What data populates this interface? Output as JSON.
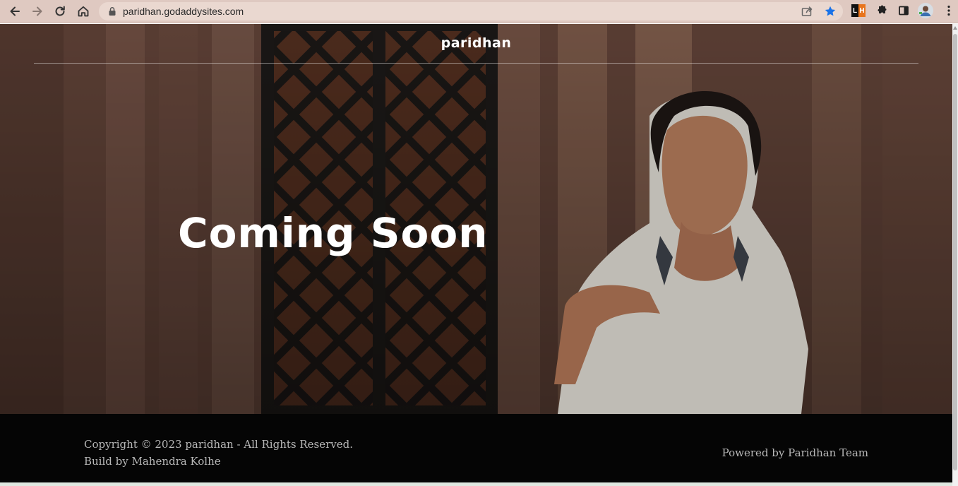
{
  "browser": {
    "url": "paridhan.godaddysites.com",
    "icons": {
      "back": "back-arrow-icon",
      "forward": "forward-arrow-icon",
      "reload": "reload-icon",
      "home": "home-icon",
      "lock": "lock-icon",
      "share": "share-icon",
      "bookmark": "star-icon",
      "extension_lh": "lighthouse-extension-icon",
      "extensions": "puzzle-icon",
      "side_panel": "side-panel-icon",
      "profile": "profile-avatar",
      "menu": "kebab-menu-icon"
    },
    "extension_lh_label": "LH",
    "accent_color": "#1a73e8"
  },
  "site": {
    "title": "paridhan",
    "headline": "Coming Soon"
  },
  "footer": {
    "copyright": "Copyright © 2023 paridhan - All Rights Reserved.",
    "build": "Build by Mahendra Kolhe",
    "powered": "Powered by Paridhan Team"
  }
}
